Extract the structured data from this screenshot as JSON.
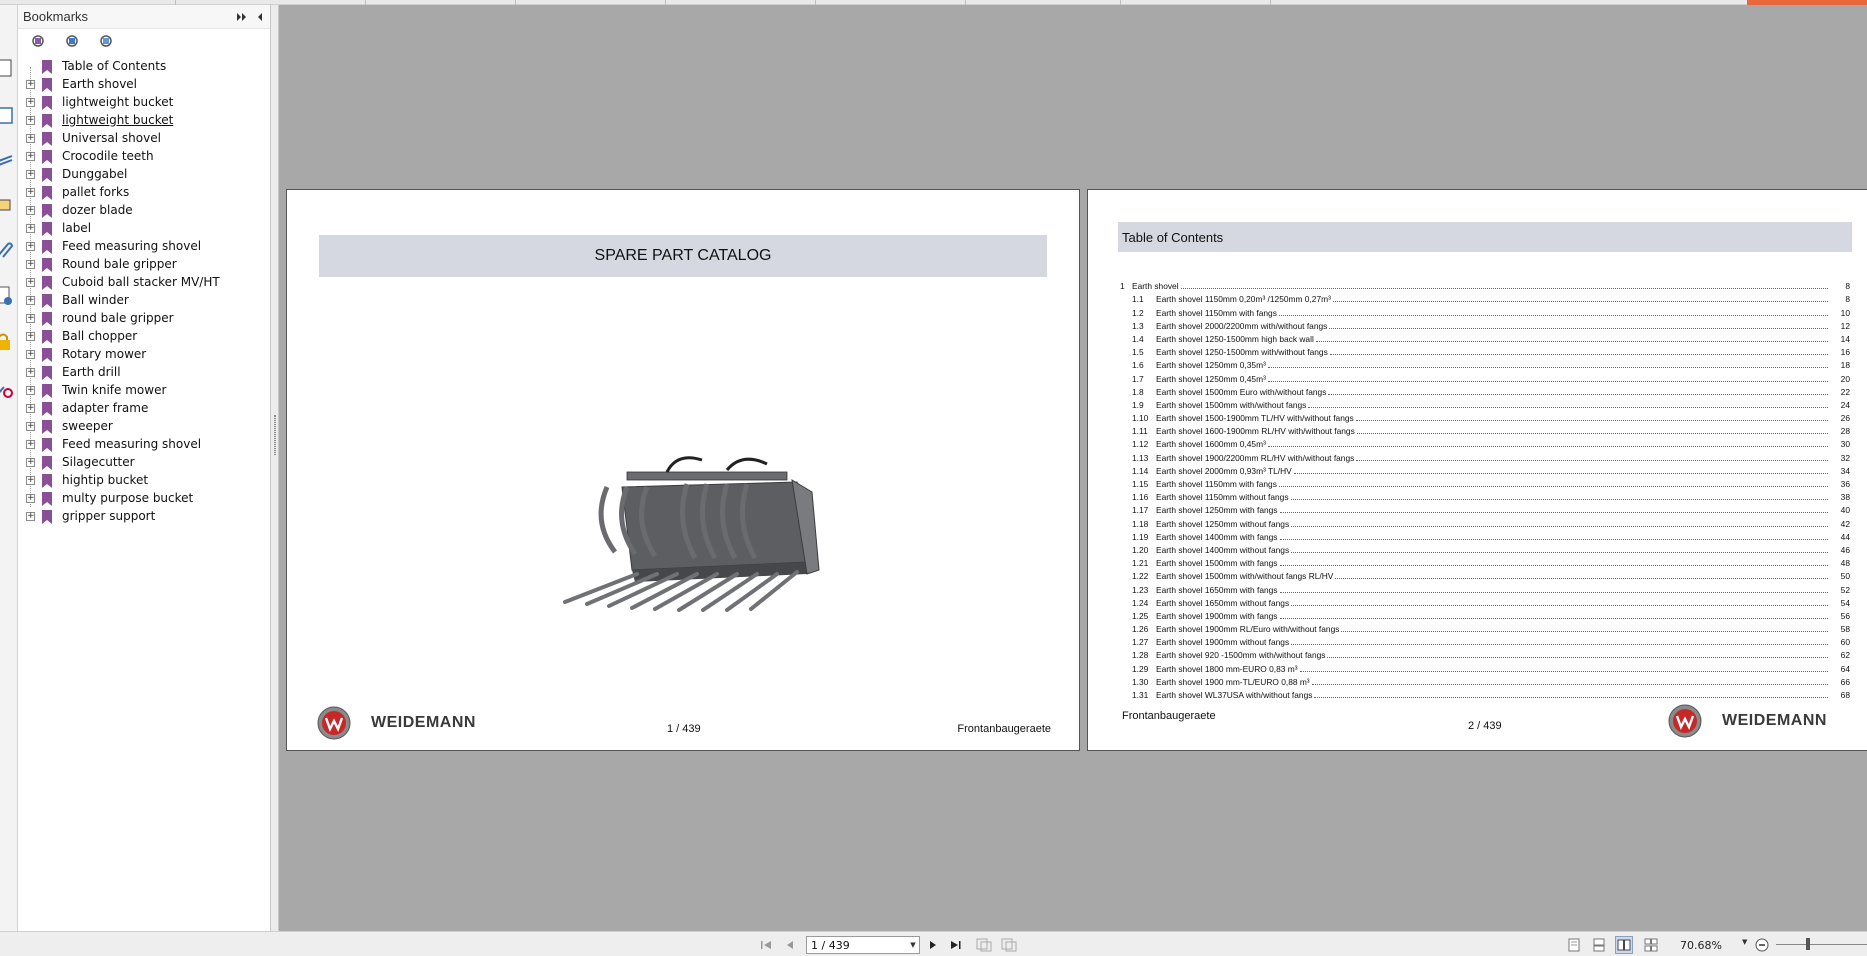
{
  "bookmarks": {
    "title": "Bookmarks",
    "items": [
      {
        "label": "Table of Contents",
        "expandable": false,
        "underline": false
      },
      {
        "label": "Earth shovel",
        "expandable": true,
        "underline": false
      },
      {
        "label": "lightweight bucket",
        "expandable": true,
        "underline": false
      },
      {
        "label": "lightweight bucket",
        "expandable": true,
        "underline": true
      },
      {
        "label": "Universal shovel",
        "expandable": true,
        "underline": false
      },
      {
        "label": "Crocodile teeth",
        "expandable": true,
        "underline": false
      },
      {
        "label": "Dunggabel",
        "expandable": true,
        "underline": false
      },
      {
        "label": "pallet forks",
        "expandable": true,
        "underline": false
      },
      {
        "label": "dozer blade",
        "expandable": true,
        "underline": false
      },
      {
        "label": "label",
        "expandable": true,
        "underline": false
      },
      {
        "label": "Feed measuring shovel",
        "expandable": true,
        "underline": false
      },
      {
        "label": "Round bale gripper",
        "expandable": true,
        "underline": false
      },
      {
        "label": "Cuboid ball stacker MV/HT",
        "expandable": true,
        "underline": false
      },
      {
        "label": "Ball winder",
        "expandable": true,
        "underline": false
      },
      {
        "label": "round bale gripper",
        "expandable": true,
        "underline": false
      },
      {
        "label": "Ball chopper",
        "expandable": true,
        "underline": false
      },
      {
        "label": "Rotary mower",
        "expandable": true,
        "underline": false
      },
      {
        "label": "Earth drill",
        "expandable": true,
        "underline": false
      },
      {
        "label": "Twin knife mower",
        "expandable": true,
        "underline": false
      },
      {
        "label": "adapter frame",
        "expandable": true,
        "underline": false
      },
      {
        "label": "sweeper",
        "expandable": true,
        "underline": false
      },
      {
        "label": "Feed measuring shovel",
        "expandable": true,
        "underline": false
      },
      {
        "label": "Silagecutter",
        "expandable": true,
        "underline": false
      },
      {
        "label": "hightip bucket",
        "expandable": true,
        "underline": false
      },
      {
        "label": "multy purpose bucket",
        "expandable": true,
        "underline": false
      },
      {
        "label": "gripper support",
        "expandable": true,
        "underline": false
      }
    ]
  },
  "page1": {
    "title": "SPARE PART CATALOG",
    "logo_text": "WEIDEMANN",
    "page_number": "1 / 439",
    "footer": "Frontanbaugeraete"
  },
  "page2": {
    "title": "Table of Contents",
    "logo_text": "WEIDEMANN",
    "page_number": "2 / 439",
    "footer": "Frontanbaugeraete",
    "toc": [
      {
        "num": "1",
        "text": "Earth shovel",
        "page": "8",
        "level": 0
      },
      {
        "num": "1.1",
        "text": "Earth shovel 1150mm 0,20m³ /1250mm 0,27m³",
        "page": "8",
        "level": 1
      },
      {
        "num": "1.2",
        "text": "Earth shovel 1150mm with fangs",
        "page": "10",
        "level": 1
      },
      {
        "num": "1.3",
        "text": "Earth shovel 2000/2200mm with/without fangs",
        "page": "12",
        "level": 1
      },
      {
        "num": "1.4",
        "text": "Earth shovel 1250-1500mm high back wall",
        "page": "14",
        "level": 1
      },
      {
        "num": "1.5",
        "text": "Earth shovel 1250-1500mm with/without fangs",
        "page": "16",
        "level": 1
      },
      {
        "num": "1.6",
        "text": "Earth shovel 1250mm 0,35m³",
        "page": "18",
        "level": 1
      },
      {
        "num": "1.7",
        "text": "Earth shovel 1250mm 0,45m³",
        "page": "20",
        "level": 1
      },
      {
        "num": "1.8",
        "text": "Earth shovel 1500mm Euro with/without fangs",
        "page": "22",
        "level": 1
      },
      {
        "num": "1.9",
        "text": "Earth shovel 1500mm with/without fangs",
        "page": "24",
        "level": 1
      },
      {
        "num": "1.10",
        "text": "Earth shovel 1500-1900mm TL/HV with/without fangs",
        "page": "26",
        "level": 1
      },
      {
        "num": "1.11",
        "text": "Earth shovel 1600-1900mm RL/HV with/without fangs",
        "page": "28",
        "level": 1
      },
      {
        "num": "1.12",
        "text": "Earth shovel 1600mm 0,45m³",
        "page": "30",
        "level": 1
      },
      {
        "num": "1.13",
        "text": "Earth shovel 1900/2200mm RL/HV with/without fangs",
        "page": "32",
        "level": 1
      },
      {
        "num": "1.14",
        "text": "Earth shovel 2000mm 0,93m³ TL/HV",
        "page": "34",
        "level": 1
      },
      {
        "num": "1.15",
        "text": "Earth shovel 1150mm with fangs",
        "page": "36",
        "level": 1
      },
      {
        "num": "1.16",
        "text": "Earth shovel 1150mm without fangs",
        "page": "38",
        "level": 1
      },
      {
        "num": "1.17",
        "text": "Earth shovel 1250mm with fangs",
        "page": "40",
        "level": 1
      },
      {
        "num": "1.18",
        "text": "Earth shovel 1250mm without fangs",
        "page": "42",
        "level": 1
      },
      {
        "num": "1.19",
        "text": "Earth shovel 1400mm with fangs",
        "page": "44",
        "level": 1
      },
      {
        "num": "1.20",
        "text": "Earth shovel 1400mm without fangs",
        "page": "46",
        "level": 1
      },
      {
        "num": "1.21",
        "text": "Earth shovel 1500mm with fangs",
        "page": "48",
        "level": 1
      },
      {
        "num": "1.22",
        "text": "Earth shovel 1500mm with/without fangs RL/HV",
        "page": "50",
        "level": 1
      },
      {
        "num": "1.23",
        "text": "Earth shovel 1650mm with fangs",
        "page": "52",
        "level": 1
      },
      {
        "num": "1.24",
        "text": "Earth shovel 1650mm without fangs",
        "page": "54",
        "level": 1
      },
      {
        "num": "1.25",
        "text": "Earth shovel 1900mm with fangs",
        "page": "56",
        "level": 1
      },
      {
        "num": "1.26",
        "text": "Earth shovel 1900mm RL/Euro with/without fangs",
        "page": "58",
        "level": 1
      },
      {
        "num": "1.27",
        "text": "Earth shovel 1900mm without fangs",
        "page": "60",
        "level": 1
      },
      {
        "num": "1.28",
        "text": "Earth shovel 920 -1500mm with/without fangs",
        "page": "62",
        "level": 1
      },
      {
        "num": "1.29",
        "text": "Earth shovel 1800 mm-EURO 0,83 m³",
        "page": "64",
        "level": 1
      },
      {
        "num": "1.30",
        "text": "Earth shovel 1900 mm-TL/EURO 0,88 m³",
        "page": "66",
        "level": 1
      },
      {
        "num": "1.31",
        "text": "Earth shovel WL37USA with/without fangs",
        "page": "68",
        "level": 1
      }
    ]
  },
  "status_bar": {
    "page_value": "1 / 439",
    "zoom": "70.68%"
  },
  "colors": {
    "bookmark_flag": "#8a4f95",
    "title_bar": "#d5d8e0",
    "background": "#a8a8a8",
    "accent": "#e9673c"
  }
}
